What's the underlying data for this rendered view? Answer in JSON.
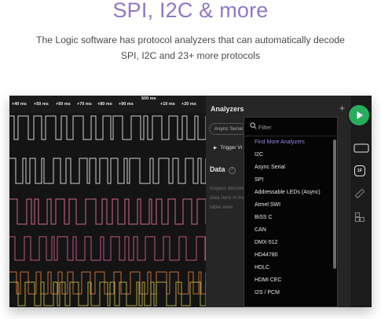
{
  "hero": {
    "title": "SPI, I2C & more",
    "subtitle": "The Logic software has protocol analyzers that can automatically decode  SPI, I2C and 23+ more protocols"
  },
  "ruler": {
    "ticks": [
      "+40 ms",
      "+50 ms",
      "+60 ms",
      "+70 ms",
      "+80 ms",
      "+90 ms",
      "+10 ms",
      "+20 ms"
    ],
    "marker": "500 ms"
  },
  "analyzers": {
    "title": "Analyzers",
    "add_icon": "plus-icon",
    "chip": "Async Serial",
    "trigger": "Trigger Vi",
    "data_title": "Data",
    "inspect_text": "Inspect decoded data here in the table view."
  },
  "dropdown": {
    "placeholder": "Filter",
    "items": [
      "Find More Analyzers",
      "I2C",
      "Async Serial",
      "SPI",
      "Addressable LEDs (Async)",
      "Atmel SWI",
      "BiSS C",
      "CAN",
      "DMX-512",
      "HD44780",
      "HDLC",
      "HDMI CEC",
      "I2S / PCM"
    ]
  },
  "toolbar": {
    "icons": [
      "play-icon",
      "device-icon",
      "analyzer-1f-icon",
      "measure-icon",
      "extensions-icon"
    ],
    "badge": "1F"
  },
  "colors": {
    "accent": "#8e78c9",
    "play": "#27ae5c",
    "wave_white": "#d9d9d9",
    "wave_pink": "#d9708c",
    "wave_magenta": "#c45a8a",
    "wave_orange": "#c8743c",
    "wave_yellow": "#c9c24a"
  }
}
